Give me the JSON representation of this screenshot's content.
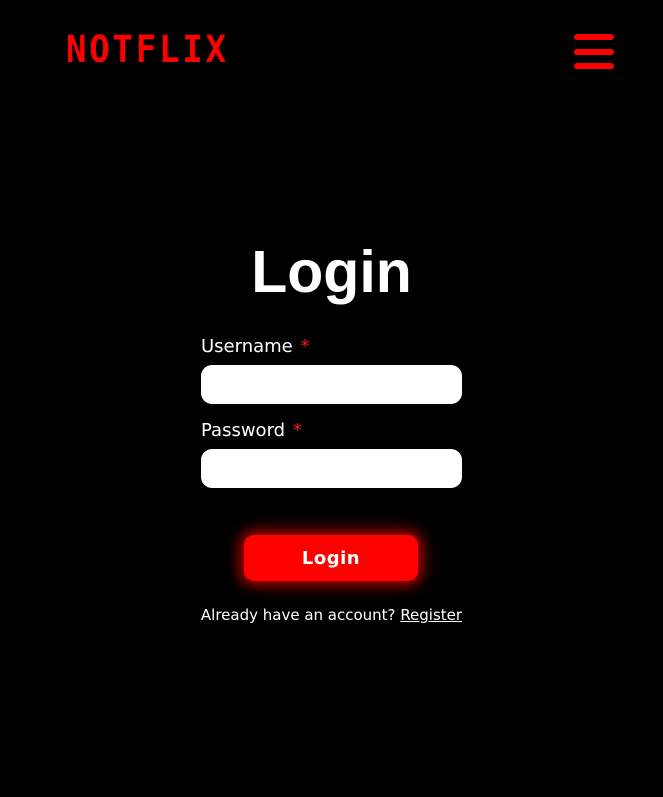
{
  "header": {
    "logo_text": "NOTFLIX",
    "menu_icon": "hamburger-menu-icon"
  },
  "main": {
    "title": "Login",
    "username": {
      "label": "Username",
      "required_mark": "*",
      "value": "",
      "placeholder": ""
    },
    "password": {
      "label": "Password",
      "required_mark": "*",
      "value": "",
      "placeholder": ""
    },
    "submit_label": "Login",
    "account_prompt": "Already have an account?",
    "register_link": "Register"
  },
  "colors": {
    "background": "#000000",
    "brand_red": "#ff0000",
    "text": "#ffffff",
    "input_bg": "#ffffff"
  }
}
